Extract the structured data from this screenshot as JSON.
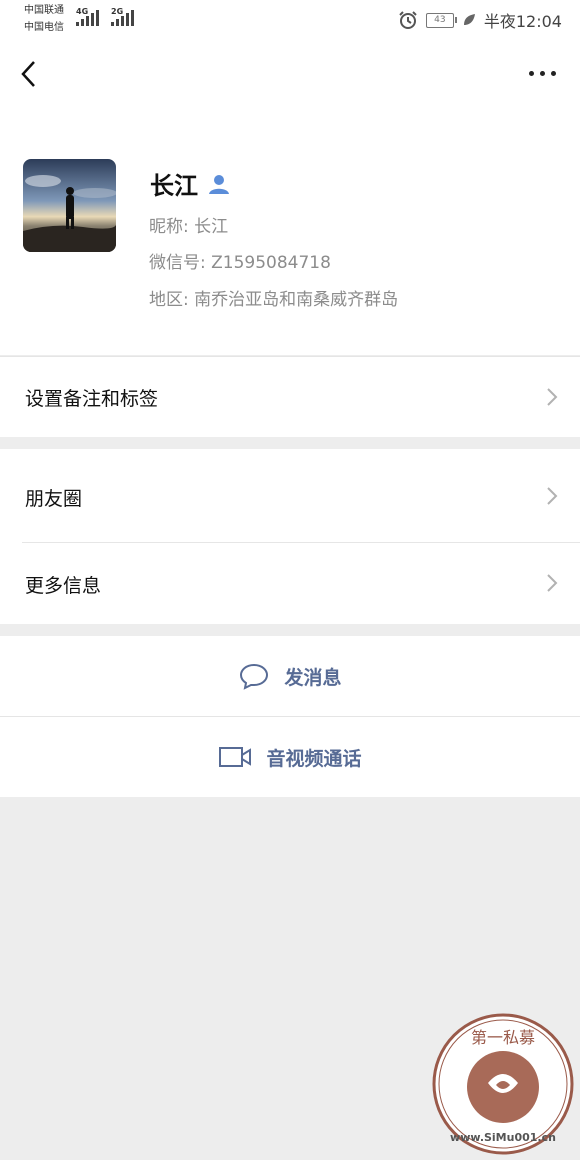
{
  "status_bar": {
    "carrier1": "中国联通",
    "carrier2": "中国电信",
    "net1": "4G",
    "net2": "2G",
    "battery": "43",
    "time": "半夜12:04"
  },
  "profile": {
    "name": "长江",
    "nickname": "昵称: 长江",
    "wechat_id": "微信号: Z1595084718",
    "region": "地区: 南乔治亚岛和南桑威齐群岛"
  },
  "menu": {
    "remark": "设置备注和标签",
    "moments": "朋友圈",
    "more_info": "更多信息"
  },
  "actions": {
    "message": "发消息",
    "call": "音视频通话"
  },
  "watermark": {
    "text": "第一私募",
    "url": "www.SiMu001.cn"
  },
  "colors": {
    "link": "#576b95",
    "background": "#ededed"
  }
}
